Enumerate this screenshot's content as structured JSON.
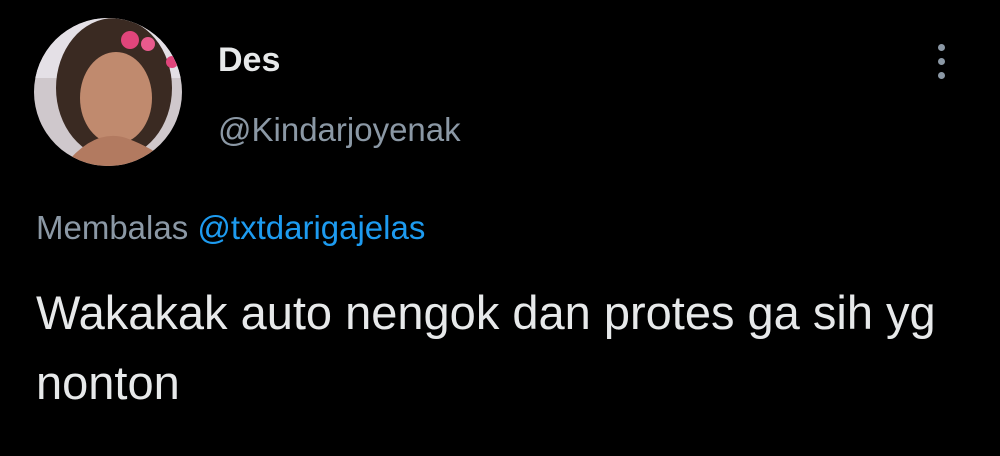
{
  "tweet": {
    "author": {
      "display_name": "Des",
      "handle": "@Kindarjoyenak"
    },
    "reply": {
      "prefix": "Membalas",
      "mention": "@txtdarigajelas"
    },
    "text": "Wakakak auto nengok dan protes ga sih yg nonton",
    "more_icon": "vertical-ellipsis-icon"
  },
  "colors": {
    "background": "#000000",
    "primary_text": "#e7e9ea",
    "secondary_text": "#8b98a5",
    "link": "#1d9bf0"
  }
}
